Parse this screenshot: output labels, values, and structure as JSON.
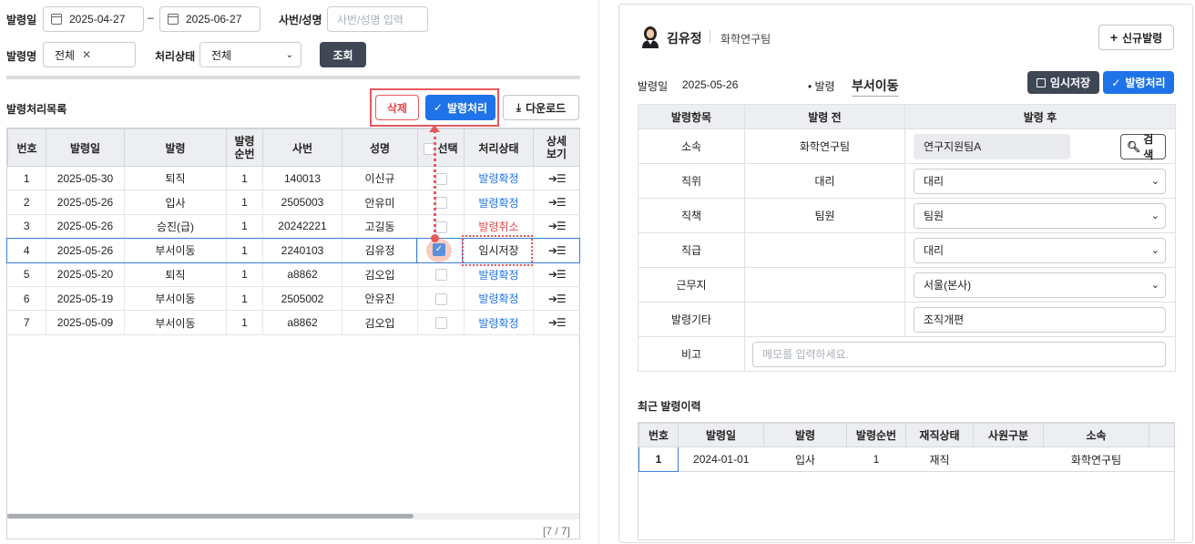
{
  "filters": {
    "date_label": "발령일",
    "date_from": "2025-04-27",
    "date_sep": "–",
    "date_to": "2025-06-27",
    "emp_label": "사번/성명",
    "emp_placeholder": "사번/성명 입력",
    "type_label": "발령명",
    "type_tag": "전체",
    "status_label": "처리상태",
    "status_value": "전체",
    "search_button": "조회"
  },
  "list": {
    "title": "발령처리목록",
    "delete_button": "삭제",
    "process_button": "발령처리",
    "download_button": "다운로드",
    "columns": [
      "번호",
      "발령일",
      "발령",
      "발령\n순번",
      "사번",
      "성명",
      "선택",
      "처리상태",
      "상세\n보기"
    ],
    "rows": [
      {
        "no": "1",
        "date": "2025-05-30",
        "type": "퇴직",
        "seq": "1",
        "emp_no": "140013",
        "name": "이신규",
        "status": "발령확정",
        "status_color": "#1f73e8",
        "checked": false
      },
      {
        "no": "2",
        "date": "2025-05-26",
        "type": "입사",
        "seq": "1",
        "emp_no": "2505003",
        "name": "안유미",
        "status": "발령확정",
        "status_color": "#1f73e8",
        "checked": false
      },
      {
        "no": "3",
        "date": "2025-05-26",
        "type": "승진(급)",
        "seq": "1",
        "emp_no": "20242221",
        "name": "고길동",
        "status": "발령취소",
        "status_color": "#e2474a",
        "checked": false
      },
      {
        "no": "4",
        "date": "2025-05-26",
        "type": "부서이동",
        "seq": "1",
        "emp_no": "2240103",
        "name": "김유정",
        "status": "임시저장",
        "status_color": "#222222",
        "checked": true
      },
      {
        "no": "5",
        "date": "2025-05-20",
        "type": "퇴직",
        "seq": "1",
        "emp_no": "a8862",
        "name": "김오입",
        "status": "발령확정",
        "status_color": "#1f73e8",
        "checked": false
      },
      {
        "no": "6",
        "date": "2025-05-19",
        "type": "부서이동",
        "seq": "1",
        "emp_no": "2505002",
        "name": "안유진",
        "status": "발령확정",
        "status_color": "#1f73e8",
        "checked": false
      },
      {
        "no": "7",
        "date": "2025-05-09",
        "type": "부서이동",
        "seq": "1",
        "emp_no": "a8862",
        "name": "김오입",
        "status": "발령확정",
        "status_color": "#1f73e8",
        "checked": false
      }
    ],
    "detail_icon_text": "➔☰",
    "pagination": "[7 / 7]"
  },
  "detail": {
    "person_name": "김유정",
    "person_dept": "화학연구팀",
    "new_button": "신규발령",
    "date_label": "발령일",
    "date_value": "2025-05-26",
    "type_label": "• 발령",
    "type_value": "부서이동",
    "temp_save_button": "임시저장",
    "process_button": "발령처리",
    "form_headers": [
      "발령항목",
      "발령 전",
      "발령 후"
    ],
    "form_rows": [
      {
        "item": "소속",
        "before": "화학연구팀",
        "after": "연구지원팀A",
        "kind": "search"
      },
      {
        "item": "직위",
        "before": "대리",
        "after": "대리",
        "kind": "select"
      },
      {
        "item": "직책",
        "before": "팀원",
        "after": "팀원",
        "kind": "select"
      },
      {
        "item": "직급",
        "before": "",
        "after": "대리",
        "kind": "select"
      },
      {
        "item": "근무지",
        "before": "",
        "after": "서울(본사)",
        "kind": "select"
      },
      {
        "item": "발령기타",
        "before": "",
        "after": "조직개편",
        "kind": "text"
      }
    ],
    "search_button": "검색",
    "remark_label": "비고",
    "remark_placeholder": "메모를 입력하세요."
  },
  "history": {
    "title": "최근 발령이력",
    "columns": [
      "번호",
      "발령일",
      "발령",
      "발령순번",
      "재직상태",
      "사원구분",
      "소속"
    ],
    "rows": [
      {
        "no": "1",
        "date": "2024-01-01",
        "type": "입사",
        "seq": "1",
        "state": "재직",
        "emp_type": "",
        "dept": "화학연구팀"
      }
    ]
  },
  "colors": {
    "accent": "#1f73e8",
    "dark_button": "#3f4756",
    "highlight_red": "#e8585c",
    "cancel_red": "#e2474a"
  }
}
